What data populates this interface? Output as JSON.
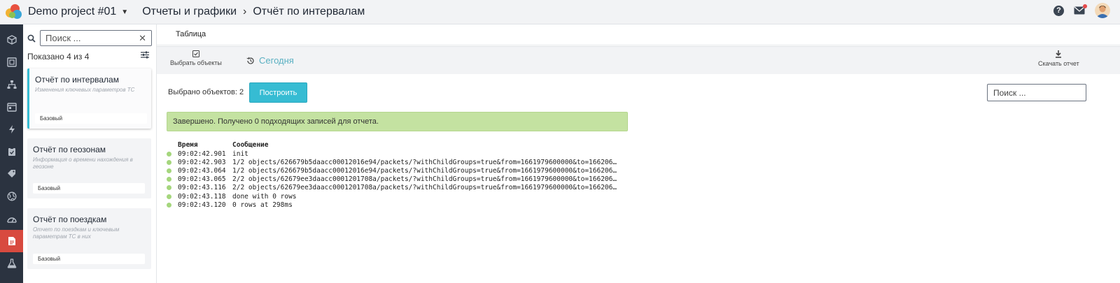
{
  "header": {
    "project_name": "Demo project #01",
    "breadcrumbs": [
      "Отчеты и графики",
      "Отчёт по интервалам"
    ]
  },
  "sidebar_icons": [
    "cube-icon",
    "square-icon",
    "hierarchy-icon",
    "calendar-icon",
    "bolt-icon",
    "clipboard-icon",
    "tag-icon",
    "globe-icon",
    "gauge-icon",
    "report-icon",
    "flask-icon"
  ],
  "reports": {
    "search_placeholder": "Поиск ...",
    "shown_text": "Показано 4 из 4",
    "items": [
      {
        "title": "Отчёт по интервалам",
        "description": "Изменения ключевых параметров ТС",
        "badge": "Базовый"
      },
      {
        "title": "Отчёт по геозонам",
        "description": "Информация о времени нахождения в геозоне",
        "badge": "Базовый"
      },
      {
        "title": "Отчёт по поездкам",
        "description": "Отчет по поездкам и ключевым параметрам ТС в них",
        "badge": "Базовый"
      }
    ]
  },
  "main": {
    "tab_label": "Таблица",
    "select_objects_label": "Выбрать объекты",
    "period_label": "Сегодня",
    "download_label": "Скачать отчет",
    "selected_text": "Выбрано объектов: 2",
    "build_label": "Построить",
    "search_placeholder": "Поиск ...",
    "alert_text": "Завершено. Получено 0 подходящих записей для отчета.",
    "log": {
      "col_time": "Время",
      "col_message": "Сообщение",
      "rows": [
        {
          "time": "09:02:42.901",
          "message": "init"
        },
        {
          "time": "09:02:42.903",
          "message": "1/2 objects/626679b5daacc00012016e94/packets/?withChildGroups=true&from=1661979600000&to=166206…"
        },
        {
          "time": "09:02:43.064",
          "message": "1/2 objects/626679b5daacc00012016e94/packets/?withChildGroups=true&from=1661979600000&to=166206…"
        },
        {
          "time": "09:02:43.065",
          "message": "2/2 objects/62679ee3daacc0001201708a/packets/?withChildGroups=true&from=1661979600000&to=166206…"
        },
        {
          "time": "09:02:43.116",
          "message": "2/2 objects/62679ee3daacc0001201708a/packets/?withChildGroups=true&from=1661979600000&to=166206…"
        },
        {
          "time": "09:02:43.118",
          "message": "done with 0 rows"
        },
        {
          "time": "09:02:43.120",
          "message": "0 rows at 298ms"
        }
      ]
    }
  },
  "colors": {
    "accent": "#36bcd3",
    "sidebar_bg": "#2b3340",
    "active_icon_bg": "#d84a3f",
    "alert_bg": "#c4e2a1",
    "log_dot": "#a5d67d"
  }
}
